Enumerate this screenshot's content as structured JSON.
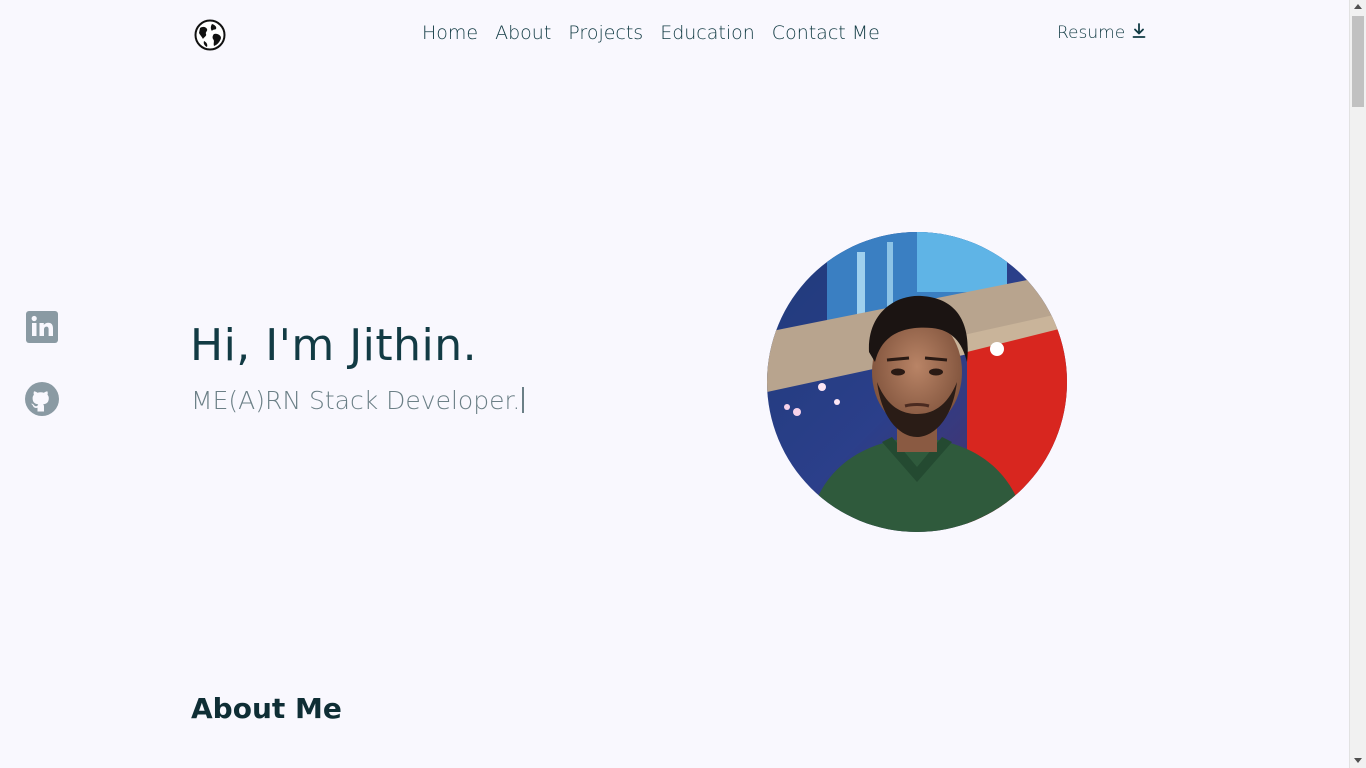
{
  "header": {
    "logo_icon": "globe-icon",
    "nav": [
      {
        "label": "Home"
      },
      {
        "label": "About"
      },
      {
        "label": "Projects"
      },
      {
        "label": "Education"
      },
      {
        "label": "Contact Me"
      }
    ],
    "resume_label": "Resume",
    "resume_icon": "download-icon"
  },
  "socials": [
    {
      "icon": "linkedin-icon"
    },
    {
      "icon": "github-icon"
    }
  ],
  "hero": {
    "title": "Hi, I'm Jithin.",
    "subtitle": "ME(A)RN Stack Developer.",
    "photo": "profile-photo"
  },
  "about": {
    "title": "About Me"
  },
  "colors": {
    "background": "#f9f8fe",
    "text_primary": "#123b44",
    "text_secondary": "#6b7f86",
    "icon_gray": "#8a9aa3"
  }
}
